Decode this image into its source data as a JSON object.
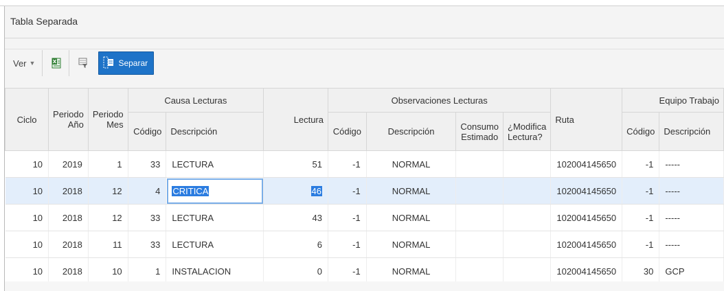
{
  "panel": {
    "title": "Tabla Separada"
  },
  "toolbar": {
    "view_label": "Ver",
    "excel_icon": "excel-export-icon",
    "filter_icon": "filter-icon",
    "separar_label": "Separar",
    "separar_icon": "split-table-icon"
  },
  "table": {
    "headers": {
      "ciclo": "Ciclo",
      "periodo_anio": "Periodo Año",
      "periodo_mes": "Periodo Mes",
      "causa_group": "Causa Lecturas",
      "causa_codigo": "Código",
      "causa_descripcion": "Descripción",
      "lectura": "Lectura",
      "obs_group": "Observaciones Lecturas",
      "obs_codigo": "Código",
      "obs_descripcion": "Descripción",
      "obs_consumo": "Consumo Estimado",
      "obs_modifica": "¿Modifica Lectura?",
      "ruta": "Ruta",
      "equipo_group": "Equipo Trabajo",
      "equipo_codigo": "Código",
      "equipo_descripcion": "Descripción"
    },
    "rows": [
      {
        "ciclo": "10",
        "anio": "2019",
        "mes": "1",
        "causa_codigo": "33",
        "causa_desc": "LECTURA",
        "lectura": "51",
        "obs_codigo": "-1",
        "obs_desc": "NORMAL",
        "consumo": "",
        "modifica": "",
        "ruta": "102004145650",
        "eq_codigo": "-1",
        "eq_desc": "-----"
      },
      {
        "ciclo": "10",
        "anio": "2018",
        "mes": "12",
        "causa_codigo": "4",
        "causa_desc": "CRITICA",
        "lectura": "46",
        "obs_codigo": "-1",
        "obs_desc": "NORMAL",
        "consumo": "",
        "modifica": "",
        "ruta": "102004145650",
        "eq_codigo": "-1",
        "eq_desc": "-----"
      },
      {
        "ciclo": "10",
        "anio": "2018",
        "mes": "12",
        "causa_codigo": "33",
        "causa_desc": "LECTURA",
        "lectura": "43",
        "obs_codigo": "-1",
        "obs_desc": "NORMAL",
        "consumo": "",
        "modifica": "",
        "ruta": "102004145650",
        "eq_codigo": "-1",
        "eq_desc": "-----"
      },
      {
        "ciclo": "10",
        "anio": "2018",
        "mes": "11",
        "causa_codigo": "33",
        "causa_desc": "LECTURA",
        "lectura": "6",
        "obs_codigo": "-1",
        "obs_desc": "NORMAL",
        "consumo": "",
        "modifica": "",
        "ruta": "102004145650",
        "eq_codigo": "-1",
        "eq_desc": "-----"
      },
      {
        "ciclo": "10",
        "anio": "2018",
        "mes": "10",
        "causa_codigo": "1",
        "causa_desc": "INSTALACION",
        "lectura": "0",
        "obs_codigo": "-1",
        "obs_desc": "NORMAL",
        "consumo": "",
        "modifica": "",
        "ruta": "102004145650",
        "eq_codigo": "30",
        "eq_desc": "GCP"
      }
    ]
  },
  "colors": {
    "accent": "#1e73c8",
    "selected_row": "#e3eefb",
    "highlight": "#2b7ce0"
  }
}
